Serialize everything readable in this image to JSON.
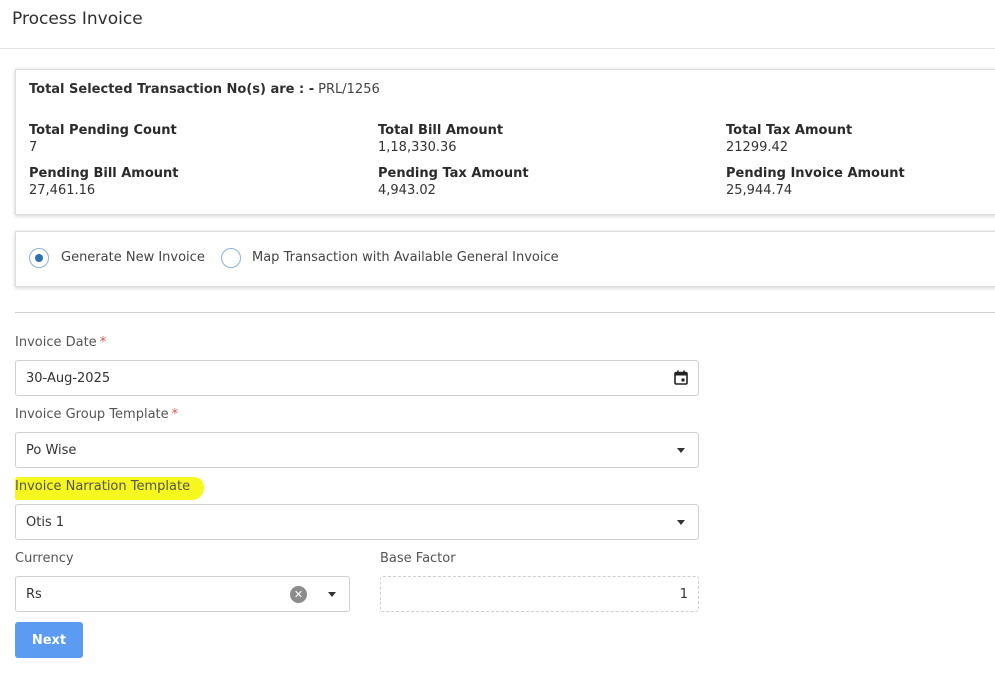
{
  "page": {
    "title": "Process Invoice"
  },
  "summary": {
    "selected_label": "Total Selected Transaction No(s) are : -",
    "selected_value": "PRL/1256",
    "stats": [
      {
        "label": "Total Pending Count",
        "value": "7"
      },
      {
        "label": "Total Bill Amount",
        "value": "1,18,330.36"
      },
      {
        "label": "Total Tax Amount",
        "value": "21299.42"
      },
      {
        "label": "Pending Bill Amount",
        "value": "27,461.16"
      },
      {
        "label": "Pending Tax Amount",
        "value": "4,943.02"
      },
      {
        "label": "Pending Invoice Amount",
        "value": "25,944.74"
      }
    ]
  },
  "options": {
    "generate_new": {
      "label": "Generate New Invoice",
      "selected": true
    },
    "map_existing": {
      "label": "Map Transaction with Available General Invoice",
      "selected": false
    }
  },
  "form": {
    "invoice_date": {
      "label": "Invoice Date",
      "required": "*",
      "value": "30-Aug-2025"
    },
    "group_template": {
      "label": "Invoice Group Template",
      "required": "*",
      "value": "Po Wise"
    },
    "narration_template": {
      "label": "Invoice Narration Template",
      "value": "Otis 1",
      "highlight_color": "#f7f720"
    },
    "currency": {
      "label": "Currency",
      "value": "Rs"
    },
    "base_factor": {
      "label": "Base Factor",
      "value": "1"
    }
  },
  "actions": {
    "next_label": "Next",
    "next_color": "#5b9cf2"
  },
  "icons": {
    "calendar": "calendar-icon",
    "clear": "clear-icon",
    "dropdown": "chevron-down-icon"
  }
}
